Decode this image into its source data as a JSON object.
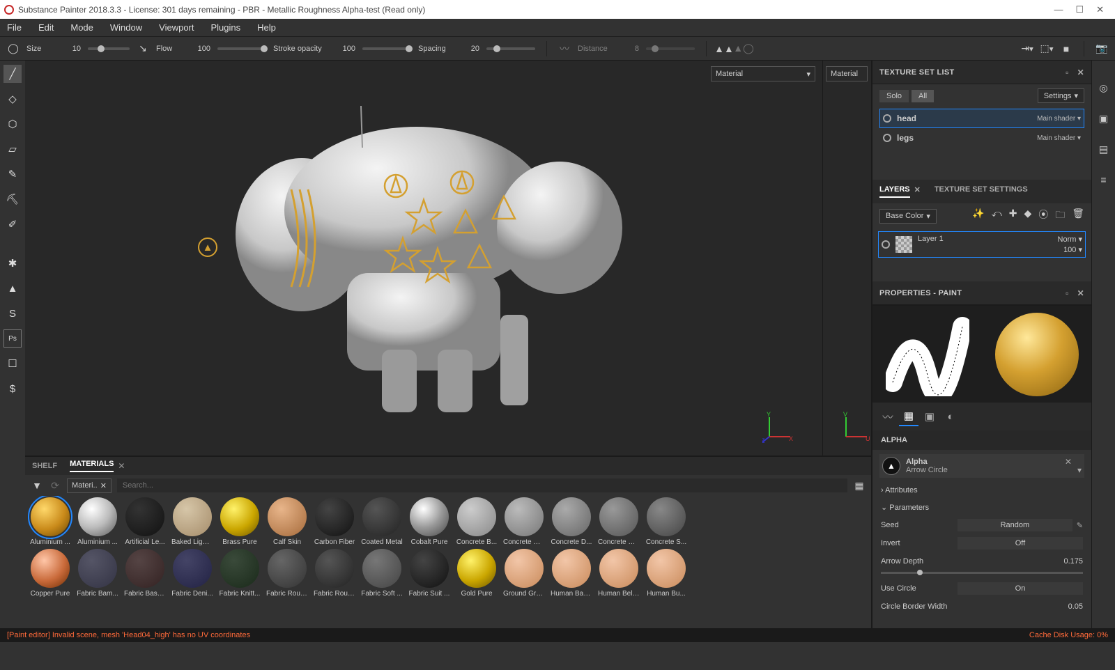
{
  "title": "Substance Painter 2018.3.3 - License: 301 days remaining - PBR - Metallic Roughness Alpha-test (Read only)",
  "menu": [
    "File",
    "Edit",
    "Mode",
    "Window",
    "Viewport",
    "Plugins",
    "Help"
  ],
  "toolbar": {
    "size_l": "Size",
    "size_v": "10",
    "flow_l": "Flow",
    "flow_v": "100",
    "opac_l": "Stroke opacity",
    "opac_v": "100",
    "spac_l": "Spacing",
    "spac_v": "20",
    "dist_l": "Distance",
    "dist_v": "8"
  },
  "viewport": {
    "dd1": "Material",
    "dd2": "Material"
  },
  "shelf": {
    "tabs": [
      "SHELF",
      "MATERIALS"
    ],
    "chip": "Materi..",
    "search_ph": "Search...",
    "row1": [
      "Aluminium ...",
      "Aluminium ...",
      "Artificial Le...",
      "Baked Light...",
      "Brass Pure",
      "Calf Skin",
      "Carbon Fiber",
      "Coated Metal",
      "Cobalt Pure",
      "Concrete B...",
      "Concrete Cl...",
      "Concrete D...",
      "Concrete Si...",
      "Concrete S..."
    ],
    "row2": [
      "Copper Pure",
      "Fabric Bam...",
      "Fabric Base...",
      "Fabric Deni...",
      "Fabric Knitt...",
      "Fabric Rough",
      "Fabric Roug...",
      "Fabric Soft ...",
      "Fabric Suit ...",
      "Gold Pure",
      "Ground Gra...",
      "Human Bac...",
      "Human Bell...",
      "Human Bu..."
    ],
    "colors1": [
      "radial-gradient(circle at 35% 30%,#ffd86a,#c98a1a 55%,#6a4600)",
      "radial-gradient(circle at 35% 30%,#fff,#bbb 50%,#555)",
      "radial-gradient(circle at 35% 30%,#333,#111)",
      "radial-gradient(circle at 35% 30%,#d6c6a8,#a58c6a)",
      "radial-gradient(circle at 35% 30%,#fff26a,#caa600 55%,#6a5300)",
      "radial-gradient(circle at 35% 30%,#e8b58a,#a56a3a)",
      "radial-gradient(circle at 35% 30%,#444,#111)",
      "radial-gradient(circle at 35% 30%,#555,#222)",
      "radial-gradient(circle at 35% 30%,#fff,#999 50%,#444)",
      "radial-gradient(circle at 35% 30%,#ccc,#888)",
      "radial-gradient(circle at 35% 30%,#bbb,#777)",
      "radial-gradient(circle at 35% 30%,#aaa,#666)",
      "radial-gradient(circle at 35% 30%,#999,#555)",
      "radial-gradient(circle at 35% 30%,#888,#444)"
    ],
    "colors2": [
      "radial-gradient(circle at 35% 30%,#ffc6a8,#c96a3a 55%,#6a2a00)",
      "radial-gradient(circle at 35% 30%,#556,#334)",
      "radial-gradient(circle at 35% 30%,#554444,#332222)",
      "radial-gradient(circle at 35% 30%,#446,#224)",
      "radial-gradient(circle at 35% 30%,#3a4a3a,#1a2a1a)",
      "radial-gradient(circle at 35% 30%,#666,#333)",
      "radial-gradient(circle at 35% 30%,#555,#222)",
      "radial-gradient(circle at 35% 30%,#777,#444)",
      "radial-gradient(circle at 35% 30%,#444,#111)",
      "radial-gradient(circle at 35% 30%,#fff26a,#caa600 55%,#6a5300)",
      "radial-gradient(circle at 35% 30%,#f2c6a8,#c98a5a)",
      "radial-gradient(circle at 35% 30%,#f2c6a8,#c98a5a)",
      "radial-gradient(circle at 35% 30%,#f2c6a8,#c98a5a)",
      "radial-gradient(circle at 35% 30%,#f2c6a8,#c98a5a)"
    ]
  },
  "txset": {
    "title": "TEXTURE SET LIST",
    "solo": "Solo",
    "all": "All",
    "settings": "Settings",
    "rows": [
      {
        "name": "head",
        "shader": "Main shader"
      },
      {
        "name": "legs",
        "shader": "Main shader"
      }
    ]
  },
  "layers": {
    "tabs": [
      "LAYERS",
      "TEXTURE SET SETTINGS"
    ],
    "channel": "Base Color",
    "layer_name": "Layer 1",
    "blend": "Norm",
    "opac": "100"
  },
  "props": {
    "title": "PROPERTIES - PAINT",
    "alpha_section": "ALPHA",
    "alpha_name": "Alpha",
    "alpha_val": "Arrow Circle",
    "attributes": "Attributes",
    "parameters": "Parameters",
    "seed_l": "Seed",
    "seed_v": "Random",
    "invert_l": "Invert",
    "invert_v": "Off",
    "depth_l": "Arrow Depth",
    "depth_v": "0.175",
    "circle_l": "Use Circle",
    "circle_v": "On",
    "border_l": "Circle Border Width",
    "border_v": "0.05"
  },
  "status": {
    "err": "[Paint editor] Invalid scene, mesh 'Head04_high' has no UV coordinates",
    "cache": "Cache Disk Usage:    0%"
  }
}
